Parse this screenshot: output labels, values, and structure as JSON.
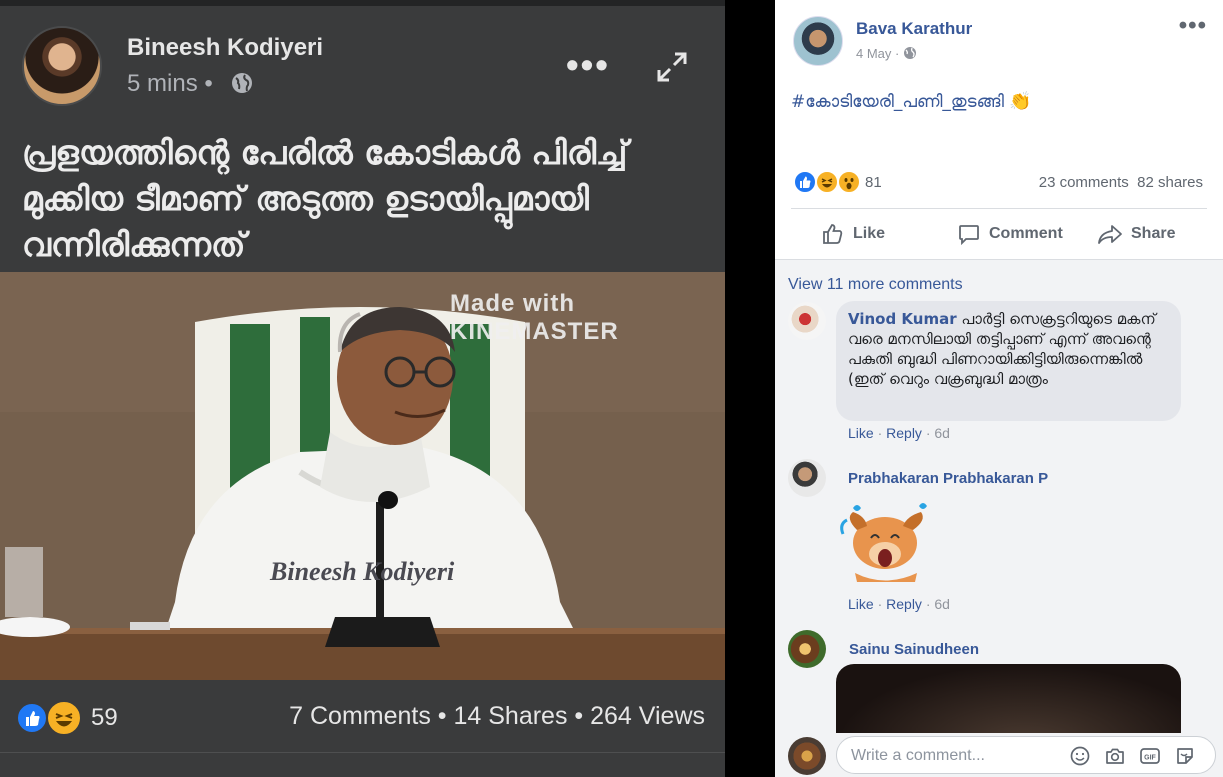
{
  "left_post": {
    "author": "Bineesh Kodiyeri",
    "time": "5 mins",
    "dot": "•",
    "text": "പ്രളയത്തിന്റെ പേരിൽ കോടികൾ പിരിച്ച് മുക്കിയ ടീമാണ് അടുത്ത ഉടായിപ്പുമായി വന്നിരിക്കുന്നത്",
    "watermark": "Made with KINEMASTER",
    "photo_caption": "Bineesh Kodiyeri",
    "reaction_count": "59",
    "stats": "7 Comments • 14 Shares • 264 Views"
  },
  "right_post": {
    "author": "Bava Karathur",
    "date": "4 May",
    "dot": "·",
    "hashtag": "#കോടിയേരി_പണി_തുടങ്ങി",
    "reaction_count": "81",
    "comments": "23 comments",
    "shares": "82 shares",
    "actions": {
      "like": "Like",
      "comment": "Comment",
      "share": "Share"
    },
    "view_more": "View 11 more comments",
    "comment_list": [
      {
        "name": "Vinod Kumar",
        "text": "പാർട്ടി സെക്രട്ടറിയുടെ മകന് വരെ മനസിലായി തട്ടിപ്പാണ് എന്ന് അവന്റെ പകുതി ബുദ്ധി പിണറായിക്കിട്ടിയിരുന്നെങ്കിൽ (ഇത് വെറും വക്രബുദ്ധി മാത്രം",
        "like": "Like",
        "reply": "Reply",
        "time": "6d"
      },
      {
        "name": "Prabhakaran Prabhakaran P",
        "like": "Like",
        "reply": "Reply",
        "time": "6d"
      },
      {
        "name": "Sainu Sainudheen"
      }
    ],
    "write_placeholder": "Write a comment..."
  },
  "colors": {
    "fb_blue": "#385898",
    "dark_bg": "#3a3b3c",
    "like_blue": "#2078f4",
    "haha_yellow": "#f7b125"
  }
}
